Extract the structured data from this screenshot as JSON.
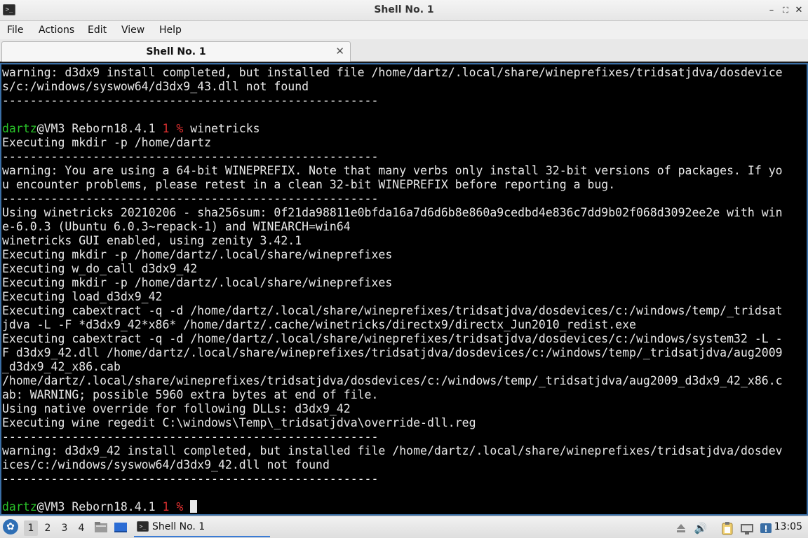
{
  "window": {
    "title": "Shell No. 1",
    "app_icon_glyph": ">_",
    "minimize_glyph": "–",
    "maximize_glyph": "⛶",
    "close_glyph": "✕"
  },
  "menu": {
    "file": "File",
    "actions": "Actions",
    "edit": "Edit",
    "view": "View",
    "help": "Help"
  },
  "tab": {
    "label": "Shell No. 1",
    "close_glyph": "✕"
  },
  "terminal": {
    "colors": {
      "background": "#000000",
      "text": "#e8e8e8",
      "user": "#29c329",
      "number": "#e03030"
    },
    "lines": [
      "warning: d3dx9 install completed, but installed file /home/dartz/.local/share/wineprefixes/tridsatjdva/dosdevice",
      "s/c:/windows/syswow64/d3dx9_43.dll not found",
      "------------------------------------------------------",
      "",
      "__PROMPT1__",
      "Executing mkdir -p /home/dartz",
      "------------------------------------------------------",
      "warning: You are using a 64-bit WINEPREFIX. Note that many verbs only install 32-bit versions of packages. If yo",
      "u encounter problems, please retest in a clean 32-bit WINEPREFIX before reporting a bug.",
      "------------------------------------------------------",
      "Using winetricks 20210206 - sha256sum: 0f21da98811e0bfda16a7d6d6b8e860a9cedbd4e836c7dd9b02f068d3092ee2e with win",
      "e-6.0.3 (Ubuntu 6.0.3~repack-1) and WINEARCH=win64",
      "winetricks GUI enabled, using zenity 3.42.1",
      "Executing mkdir -p /home/dartz/.local/share/wineprefixes",
      "Executing w_do_call d3dx9_42",
      "Executing mkdir -p /home/dartz/.local/share/wineprefixes",
      "Executing load_d3dx9_42",
      "Executing cabextract -q -d /home/dartz/.local/share/wineprefixes/tridsatjdva/dosdevices/c:/windows/temp/_tridsat",
      "jdva -L -F *d3dx9_42*x86* /home/dartz/.cache/winetricks/directx9/directx_Jun2010_redist.exe",
      "Executing cabextract -q -d /home/dartz/.local/share/wineprefixes/tridsatjdva/dosdevices/c:/windows/system32 -L -",
      "F d3dx9_42.dll /home/dartz/.local/share/wineprefixes/tridsatjdva/dosdevices/c:/windows/temp/_tridsatjdva/aug2009",
      "_d3dx9_42_x86.cab",
      "/home/dartz/.local/share/wineprefixes/tridsatjdva/dosdevices/c:/windows/temp/_tridsatjdva/aug2009_d3dx9_42_x86.c",
      "ab: WARNING; possible 5960 extra bytes at end of file.",
      "Using native override for following DLLs: d3dx9_42",
      "Executing wine regedit C:\\windows\\Temp\\_tridsatjdva\\override-dll.reg",
      "------------------------------------------------------",
      "warning: d3dx9_42 install completed, but installed file /home/dartz/.local/share/wineprefixes/tridsatjdva/dosdev",
      "ices/c:/windows/syswow64/d3dx9_42.dll not found",
      "------------------------------------------------------",
      "",
      "__PROMPT2__"
    ],
    "prompt1": {
      "user": "dartz",
      "host": "@VM3 Reborn18.4.1 ",
      "num": "1 %",
      "command": " winetricks"
    },
    "prompt2": {
      "user": "dartz",
      "host": "@VM3 Reborn18.4.1 ",
      "num": "1 %",
      "command": " "
    }
  },
  "taskbar": {
    "start_icon": "start-menu-icon",
    "workspaces": [
      "1",
      "2",
      "3",
      "4"
    ],
    "active_workspace": "1",
    "task_label": "Shell No. 1",
    "task_icon_glyph": ">_",
    "tray_volume_glyph": "🔊",
    "clock": "13:05"
  }
}
